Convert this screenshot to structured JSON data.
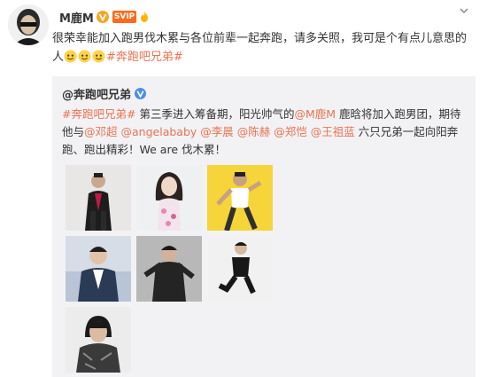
{
  "post": {
    "author": "M鹿M",
    "member_badge": "SVIP",
    "text_main": "很荣幸能加入跑男伐木累与各位前辈一起奔跑，请多关照，我可是个有点儿意思的人",
    "hashtag": "#奔跑吧兄弟#"
  },
  "repost": {
    "author": "@奔跑吧兄弟",
    "hashtag": "#奔跑吧兄弟#",
    "text_1": "第三季进入筹备期，阳光帅气的",
    "mention_luhan": "@M鹿M",
    "text_2": "鹿晗将加入跑男团，期待他与",
    "mention_1": "@邓超",
    "mention_2": "@angelababy",
    "mention_3": "@李晨",
    "mention_4": "@陈赫",
    "mention_5": "@郑恺",
    "mention_6": "@王祖蓝",
    "text_3": "六只兄弟一起向阳奔跑、跑出精彩！We are 伐木累！",
    "photos": [
      "photo-1",
      "photo-2",
      "photo-3",
      "photo-4",
      "photo-5",
      "photo-6",
      "photo-7"
    ]
  },
  "colors": {
    "link": "#eb7350",
    "mention_blue": "#eb7350",
    "verified": "#f5a623",
    "card_bg": "#f2f2f5"
  },
  "icons": [
    "avatar",
    "verified-icon",
    "member-badge-icon",
    "fire-icon",
    "chevron-down-icon",
    "emoji-face-icon"
  ]
}
